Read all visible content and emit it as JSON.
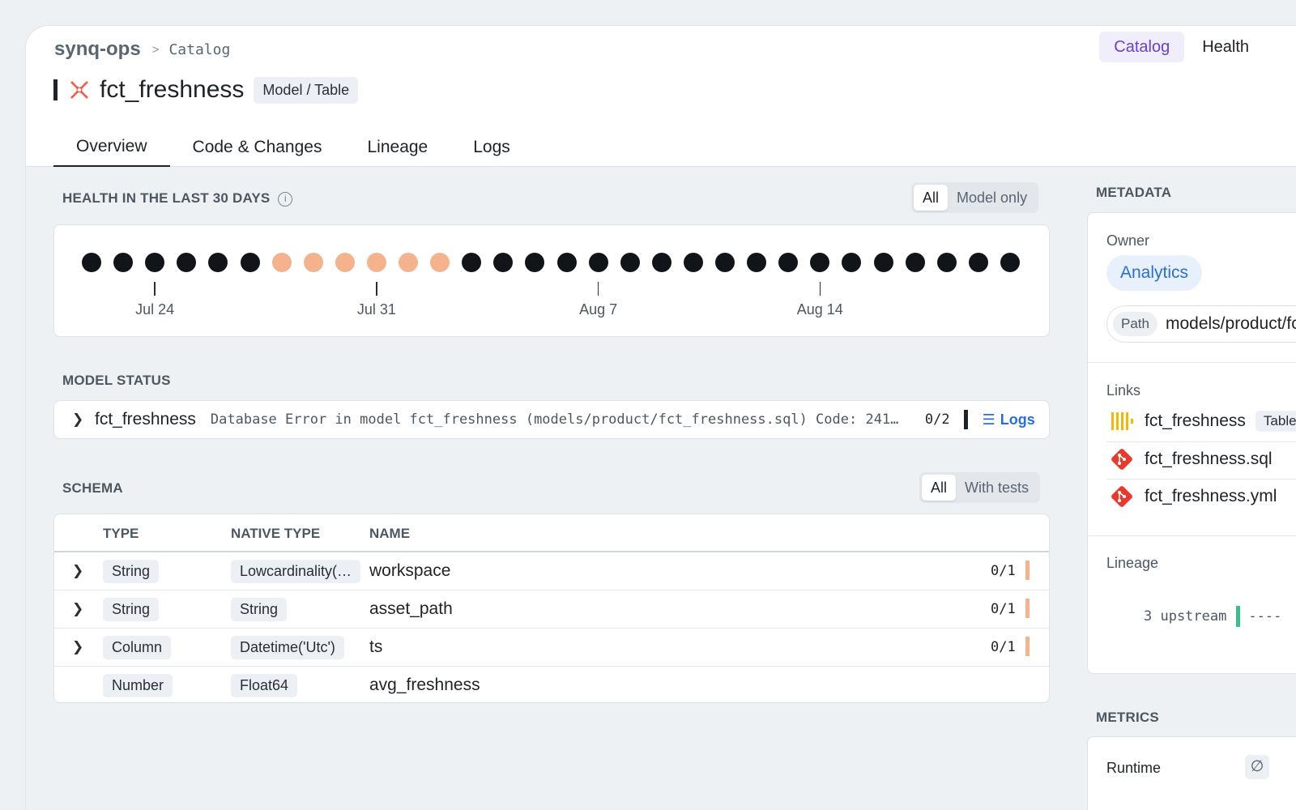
{
  "breadcrumb": {
    "org": "synq-ops",
    "page": "Catalog"
  },
  "topnav": {
    "items": [
      {
        "label": "Catalog",
        "active": true
      },
      {
        "label": "Health",
        "active": false
      }
    ]
  },
  "entity": {
    "title": "fct_freshness",
    "type": "Model / Table",
    "icon": "dbt-icon"
  },
  "tabs": [
    "Overview",
    "Code & Changes",
    "Lineage",
    "Logs"
  ],
  "health": {
    "title": "HEALTH IN THE LAST 30 DAYS",
    "filter": {
      "all": "All",
      "model_only": "Model only"
    },
    "days": [
      "ok",
      "ok",
      "ok",
      "ok",
      "ok",
      "ok",
      "warn",
      "warn",
      "warn",
      "warn",
      "warn",
      "warn",
      "ok",
      "ok",
      "ok",
      "ok",
      "ok",
      "ok",
      "ok",
      "ok",
      "ok",
      "ok",
      "ok",
      "ok",
      "ok",
      "ok",
      "ok",
      "ok",
      "ok",
      "ok"
    ],
    "ticks": [
      "Jul 24",
      "Jul 31",
      "Aug 7",
      "Aug 14"
    ],
    "colors": {
      "ok": "#111418",
      "warn": "#f5b38d"
    }
  },
  "model_status": {
    "title": "MODEL STATUS",
    "name": "fct_freshness",
    "message": "Database Error in model fct_freshness (models/product/fct_freshness.sql) Code: 241…",
    "count": "0/2",
    "logs_label": "Logs"
  },
  "schema": {
    "title": "SCHEMA",
    "filter": {
      "all": "All",
      "with_tests": "With tests"
    },
    "headers": {
      "type": "TYPE",
      "native_type": "NATIVE TYPE",
      "name": "NAME"
    },
    "rows": [
      {
        "type": "String",
        "native": "Lowcardinality(…",
        "name": "workspace",
        "count": "0/1"
      },
      {
        "type": "String",
        "native": "String",
        "name": "asset_path",
        "count": "0/1"
      },
      {
        "type": "Column",
        "native": "Datetime('Utc')",
        "name": "ts",
        "count": "0/1"
      },
      {
        "type": "Number",
        "native": "Float64",
        "name": "avg_freshness",
        "count": ""
      }
    ]
  },
  "metadata": {
    "title": "METADATA",
    "owner_label": "Owner",
    "owner": "Analytics",
    "path_label": "Path",
    "path_value": "models/product/fct_freshness.sql",
    "links_label": "Links",
    "links": [
      {
        "text": "fct_freshness",
        "icon": "columns-icon",
        "tag": "Table"
      },
      {
        "text": "fct_freshness.sql",
        "icon": "git-icon"
      },
      {
        "text": "fct_freshness.yml",
        "icon": "git-icon"
      }
    ],
    "lineage_label": "Lineage",
    "lineage_upstream": "3 upstream"
  },
  "metrics": {
    "title": "METRICS",
    "runtime_label": "Runtime",
    "runtime_icon": "empty-set-icon"
  }
}
